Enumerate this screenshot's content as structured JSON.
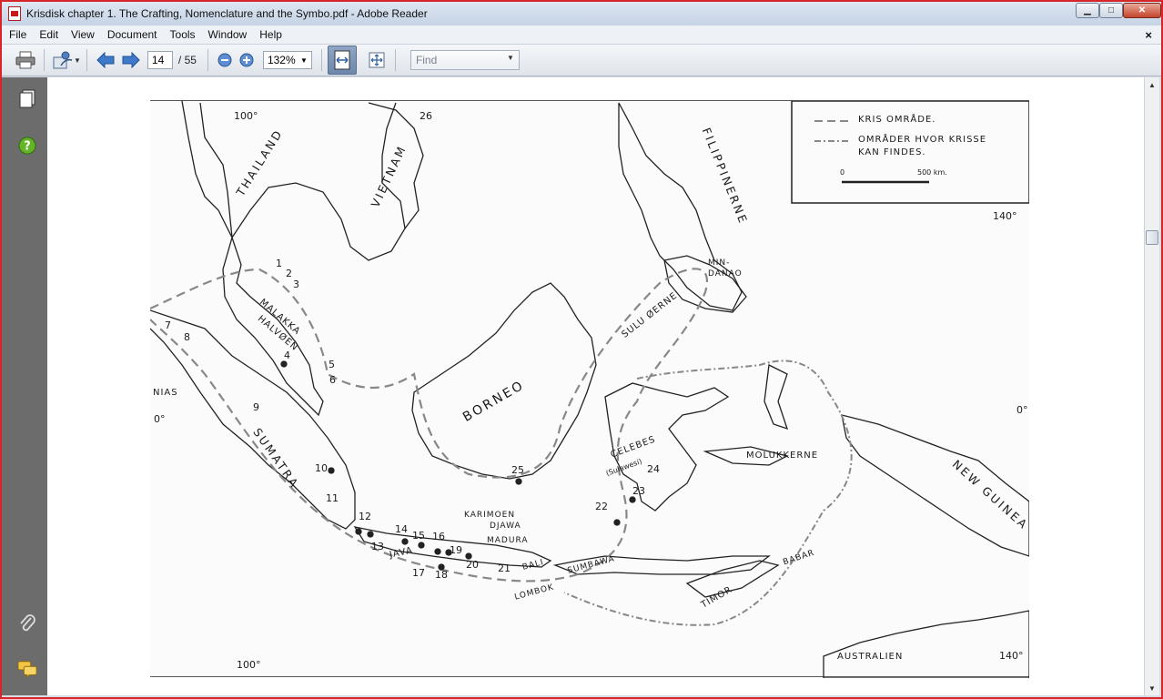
{
  "window": {
    "title": "Krisdisk chapter 1. The Crafting, Nomenclature and the Symbo.pdf - Adobe Reader",
    "controls": {
      "minimize": "▁",
      "maximize": "□",
      "close": "✕"
    }
  },
  "menu": [
    "File",
    "Edit",
    "View",
    "Document",
    "Tools",
    "Window",
    "Help"
  ],
  "doc_close": "×",
  "toolbar": {
    "page_current": "14",
    "page_total": "/ 55",
    "zoom": "132%",
    "find_placeholder": "Find"
  },
  "map": {
    "legend": {
      "kris_area": "KRIS OMRÅDE.",
      "where_found_1": "OMRÅDER HVOR KRISSE",
      "where_found_2": "KAN FINDES.",
      "scale_start": "0",
      "scale_end": "500 km."
    },
    "degrees": [
      "100°",
      "140°",
      "100°",
      "140°",
      "0°",
      "0°"
    ],
    "regions": {
      "thailand": "THAILAND",
      "vietnam": "VIETNAM",
      "filippinerne": "FILIPPINERNE",
      "mindanao_1": "MIN-",
      "mindanao_2": "DANAO",
      "malakka_1": "MALAKKA",
      "malakka_2": "HALVØEN",
      "sulu": "SULU ØERNE",
      "borneo": "BORNEO",
      "nias": "NIAS",
      "sumatra": "SUMATRA",
      "celebes": "CELEBES",
      "sulawesi": "(Sulawesi)",
      "molukkerne": "MOLUKKERNE",
      "new_guinea": "NEW GUINEA",
      "karimoen_1": "KARIMOEN",
      "karimoen_2": "DJAWA",
      "madura": "MADURA",
      "java": "JAVA",
      "bali": "BALI",
      "lombok": "LOMBOK",
      "sumbawa": "SUMBAWA",
      "timor": "TIMOR",
      "babar": "BABAR",
      "australien": "AUSTRALIEN"
    },
    "numbers": [
      "1",
      "2",
      "3",
      "4",
      "5",
      "6",
      "7",
      "8",
      "9",
      "10",
      "11",
      "12",
      "13",
      "14",
      "15",
      "16",
      "17",
      "18",
      "19",
      "20",
      "21",
      "22",
      "23",
      "24",
      "25",
      "26"
    ]
  }
}
